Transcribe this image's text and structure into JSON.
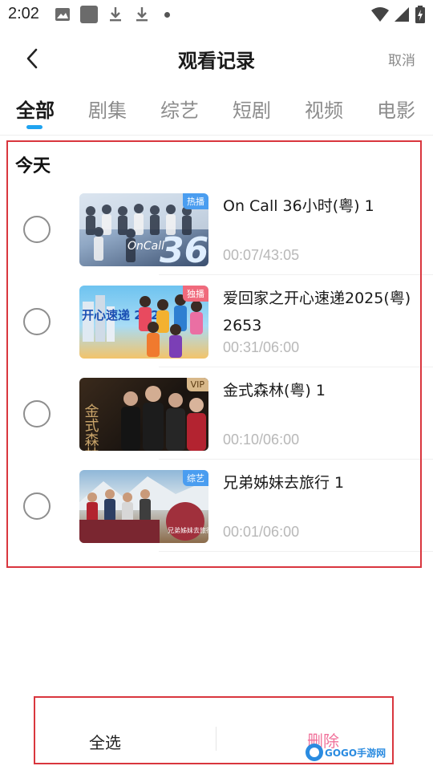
{
  "status_bar": {
    "time": "2:02",
    "icons": [
      "gallery-icon",
      "app-square-icon",
      "download-icon",
      "download-icon",
      "dot-icon",
      "wifi-icon",
      "signal-icon",
      "battery-charging-icon"
    ]
  },
  "header": {
    "title": "观看记录",
    "back_icon": "chevron-left-icon",
    "cancel_label": "取消"
  },
  "tabs": [
    {
      "label": "全部",
      "active": true
    },
    {
      "label": "剧集",
      "active": false
    },
    {
      "label": "综艺",
      "active": false
    },
    {
      "label": "短剧",
      "active": false
    },
    {
      "label": "视频",
      "active": false
    },
    {
      "label": "电影",
      "active": false
    }
  ],
  "colors": {
    "accent": "#1fa3f0",
    "delete": "#f0719a",
    "highlight": "#d9363e",
    "badge_hot": "#4a9df0",
    "badge_exclusive": "#f06a7c",
    "badge_vip": "#d8b88a",
    "badge_variety": "#4a9df0"
  },
  "section": {
    "title": "今天"
  },
  "items": [
    {
      "title": "On Call 36小时(粤) 1",
      "progress": "00:07/43:05",
      "badge": "热播",
      "thumb_text": "36",
      "selected": false
    },
    {
      "title": "爱回家之开心速递2025(粤) 2653",
      "progress": "00:31/06:00",
      "badge": "独播",
      "thumb_text": "开心速递 2025",
      "selected": false
    },
    {
      "title": "金式森林(粤) 1",
      "progress": "00:10/06:00",
      "badge": "VIP",
      "thumb_text": "金式森林",
      "selected": false
    },
    {
      "title": "兄弟姊妹去旅行 1",
      "progress": "00:01/06:00",
      "badge": "综艺",
      "thumb_text": "兄弟姊妹去旅行",
      "selected": false
    }
  ],
  "bottom_bar": {
    "select_all_label": "全选",
    "delete_label": "删除"
  },
  "watermark": {
    "text": "GOGO手游网"
  }
}
